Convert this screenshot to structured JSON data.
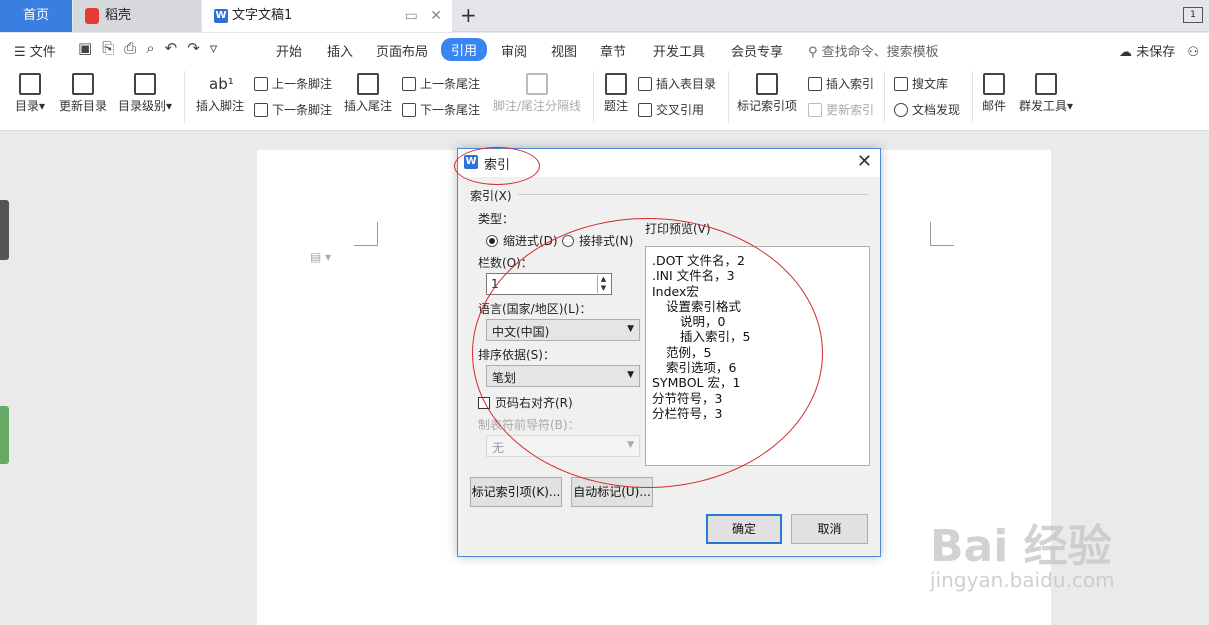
{
  "tabs": {
    "home": "首页",
    "daoke": "稻壳",
    "doc": "文字文稿1",
    "page_indicator": "1"
  },
  "menu": {
    "file": "文件",
    "items": [
      "开始",
      "插入",
      "页面布局",
      "引用",
      "审阅",
      "视图",
      "章节",
      "开发工具",
      "会员专享"
    ],
    "active": "引用",
    "search": "查找命令、搜索模板",
    "save_status": "未保存"
  },
  "ribbon": {
    "toc": "目录",
    "update_toc": "更新目录",
    "toc_level": "目录级别",
    "insert_footnote": "插入脚注",
    "prev_footnote": "上一条脚注",
    "next_footnote": "下一条脚注",
    "insert_endnote": "插入尾注",
    "prev_endnote": "上一条尾注",
    "next_endnote": "下一条尾注",
    "note_separator": "脚注/尾注分隔线",
    "caption": "题注",
    "insert_table_toc": "插入表目录",
    "cross_ref": "交叉引用",
    "mark_index": "标记索引项",
    "insert_index": "插入索引",
    "update_index": "更新索引",
    "search_lib": "搜文库",
    "doc_discover": "文档发现",
    "mail": "邮件",
    "mass_tools": "群发工具"
  },
  "dialog": {
    "title": "索引",
    "group_label": "索引(X)",
    "type_label": "类型：",
    "type_indented": "缩进式(D)",
    "type_runin": "接排式(N)",
    "columns_label": "栏数(O)：",
    "columns_value": "1",
    "language_label": "语言(国家/地区)(L)：",
    "language_value": "中文(中国)",
    "sort_label": "排序依据(S)：",
    "sort_value": "笔划",
    "right_align_label": "页码右对齐(R)",
    "leader_label": "制表符前导符(B)：",
    "leader_value": "无",
    "preview_label": "打印预览(V)",
    "preview_lines": [
      ".DOT 文件名，2",
      ".INI 文件名，3",
      "Index宏",
      "   设置索引格式",
      "      说明，0",
      "      插入索引，5",
      "   范例，5",
      "   索引选项，6",
      "SYMBOL 宏，1",
      "分节符号，3",
      "分栏符号，3"
    ],
    "btn_mark": "标记索引项(K)...",
    "btn_auto": "自动标记(U)...",
    "btn_ok": "确定",
    "btn_cancel": "取消"
  },
  "watermark": {
    "main": "Bai 经验",
    "sub": "jingyan.baidu.com"
  }
}
